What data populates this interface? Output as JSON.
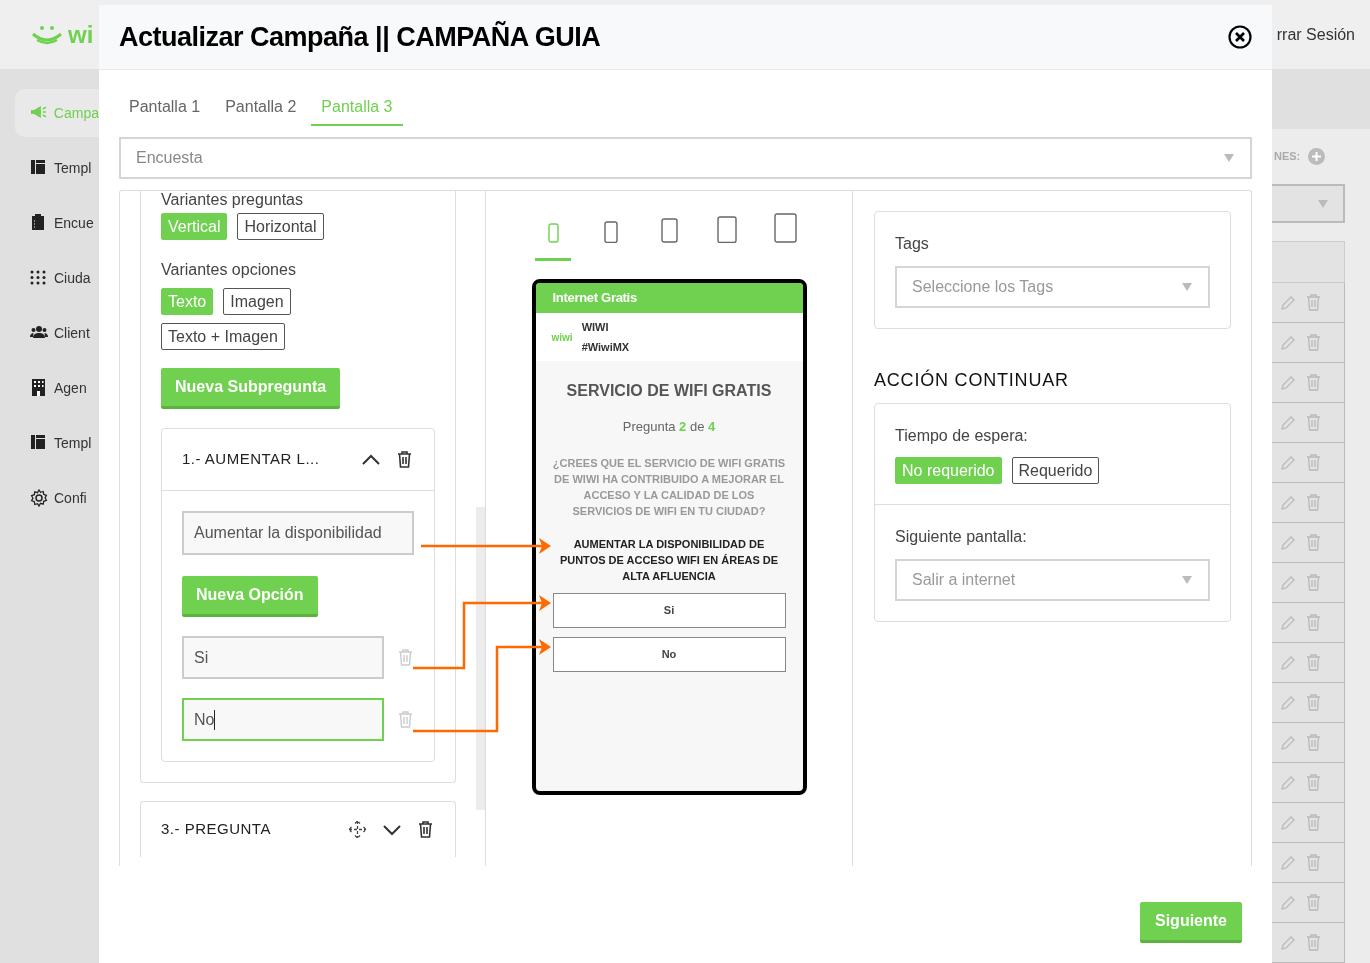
{
  "background_app": {
    "logo": "wi",
    "logout": "rrar Sesión",
    "filter_label": "NES:",
    "sidebar": [
      {
        "label": "Campa",
        "selected": true
      },
      {
        "label": "Templ",
        "selected": false
      },
      {
        "label": "Encue",
        "selected": false
      },
      {
        "label": "Ciuda",
        "selected": false
      },
      {
        "label": "Client",
        "selected": false
      },
      {
        "label": "Agen",
        "selected": false
      },
      {
        "label": "Templ",
        "selected": false
      },
      {
        "label": "Confi",
        "selected": false
      }
    ]
  },
  "modal": {
    "title": "Actualizar Campaña || CAMPAÑA GUIA"
  },
  "tabs": [
    {
      "label": "Pantalla 1",
      "selected": false
    },
    {
      "label": "Pantalla 2",
      "selected": false
    },
    {
      "label": "Pantalla 3",
      "selected": true
    }
  ],
  "screen_type": {
    "value": "Encuesta"
  },
  "editor": {
    "question_variants_label": "Variantes preguntas",
    "question_variants": [
      {
        "label": "Vertical",
        "selected": true
      },
      {
        "label": "Horizontal",
        "selected": false
      }
    ],
    "option_variants_label": "Variantes opciones",
    "option_variants": [
      {
        "label": "Texto",
        "selected": true
      },
      {
        "label": "Imagen",
        "selected": false
      },
      {
        "label": "Texto + Imagen",
        "selected": false
      }
    ],
    "new_subquestion": "Nueva Subpregunta",
    "subquestion": {
      "title": "1.- AUMENTAR L...",
      "expanded": true,
      "text": "Aumentar la disponibilidad",
      "new_option": "Nueva Opción",
      "options": [
        {
          "value": "Si",
          "focused": false
        },
        {
          "value": "No",
          "focused": true
        }
      ]
    },
    "next_question": {
      "title": "3.- PREGUNTA",
      "expanded": false
    }
  },
  "preview": {
    "devices": [
      {
        "selected": true
      },
      {
        "selected": false
      },
      {
        "selected": false
      },
      {
        "selected": false
      },
      {
        "selected": false
      }
    ],
    "header": "Internet Gratis",
    "brand_logo": "wiwi",
    "brand_name": "WIWI",
    "hashtag": "#WiwiMX",
    "title": "SERVICIO DE WIFI GRATIS",
    "progress": "Pregunta **2** de **4**",
    "question": "¿CREES QUE EL SERVICIO DE WIFI GRATIS DE WIWI HA CONTRIBUIDO A MEJORAR EL ACCESO Y LA CALIDAD DE LOS SERVICIOS DE WIFI EN TU CIUDAD?",
    "subquestion": "AUMENTAR LA DISPONIBILIDAD DE PUNTOS DE ACCESO WIFI EN ÁREAS DE ALTA AFLUENCIA",
    "options": [
      "Si",
      "No"
    ]
  },
  "settings": {
    "tags_label": "Tags",
    "tags_placeholder": "Seleccione los Tags",
    "section_title": "ACCIÓN CONTINUAR",
    "wait_label": "Tiempo de espera:",
    "wait_options": [
      {
        "label": "No requerido",
        "selected": true
      },
      {
        "label": "Requerido",
        "selected": false
      }
    ],
    "next_screen_label": "Siguiente pantalla:",
    "next_screen_value": "Salir a internet"
  },
  "footer": {
    "next_button": "Siguiente"
  }
}
